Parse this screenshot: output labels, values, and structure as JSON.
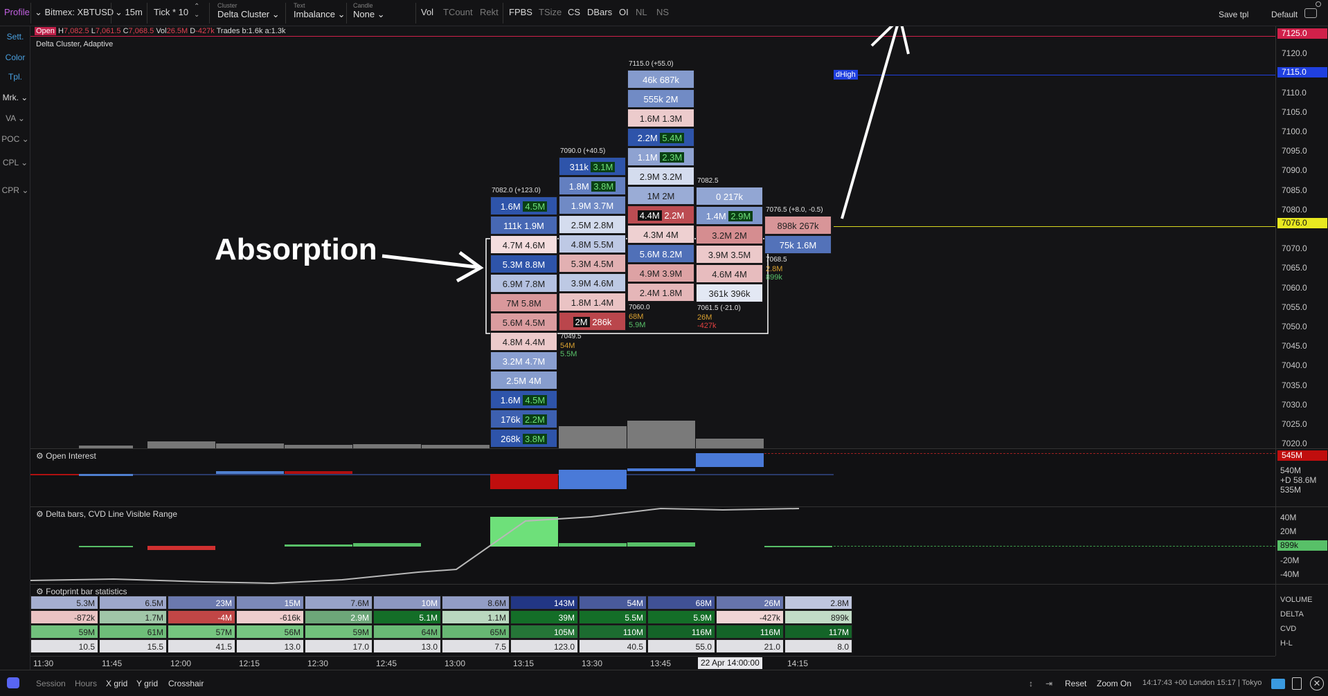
{
  "toolbar": {
    "profile": "Profile",
    "symbol": "Bitmex: XBTUSD",
    "timeframe": "15m",
    "tick": "Tick * 10",
    "cluster_caption": "Cluster",
    "cluster_value": "Delta Cluster",
    "text_caption": "Text",
    "text_value": "Imbalance",
    "candle_caption": "Candle",
    "candle_value": "None",
    "toggles": [
      "Vol",
      "TCount",
      "Rekt",
      "FPBS",
      "TSize",
      "CS",
      "DBars",
      "OI",
      "NL",
      "NS"
    ],
    "save_tpl": "Save tpl",
    "default": "Default"
  },
  "sidebar": [
    "Sett.",
    "Color",
    "Tpl.",
    "Mrk.",
    "VA",
    "POC",
    "CPL",
    "CPR"
  ],
  "chart": {
    "ohlc_open": "Open",
    "ohlc_h_label": "H",
    "ohlc_h": "7,082.5",
    "ohlc_l_label": "L",
    "ohlc_l": "7,061.5",
    "ohlc_c_label": "C",
    "ohlc_c": "7,068.5",
    "vol_label": "Vol",
    "vol": "26.5M",
    "delta_label": "D",
    "delta": "-427k",
    "trades": "Trades b:1.6k a:1.3k",
    "indicator_name": "Delta Cluster, Adaptive",
    "annotation": "Absorption",
    "dhigh": "dHigh",
    "bars": [
      {
        "header": "7082.0 (+123.0)",
        "cells": [
          [
            "1.6M",
            "4.5M"
          ],
          [
            "111k",
            "1.9M"
          ],
          [
            "4.7M",
            "4.6M"
          ],
          [
            "5.3M",
            "8.8M"
          ],
          [
            "6.9M",
            "7.8M"
          ],
          [
            "7M",
            "5.8M"
          ],
          [
            "5.6M",
            "4.5M"
          ],
          [
            "4.8M",
            "4.4M"
          ],
          [
            "3.2M",
            "4.7M"
          ],
          [
            "2.5M",
            "4M"
          ],
          [
            "1.6M",
            "4.5M"
          ],
          [
            "176k",
            "2.2M"
          ],
          [
            "268k",
            "3.8M"
          ]
        ]
      },
      {
        "header": "7090.0 (+40.5)",
        "cells": [
          [
            "311k",
            "3.1M"
          ],
          [
            "1.8M",
            "3.8M"
          ],
          [
            "1.9M",
            "3.7M"
          ],
          [
            "2.5M",
            "2.8M"
          ],
          [
            "4.8M",
            "5.5M"
          ],
          [
            "5.3M",
            "4.5M"
          ],
          [
            "3.9M",
            "4.6M"
          ],
          [
            "1.8M",
            "1.4M"
          ],
          [
            "2M",
            "286k"
          ]
        ],
        "footer": "7049.5",
        "fvol": "54M",
        "fdelta": "5.5M"
      },
      {
        "header": "7115.0 (+55.0)",
        "cells": [
          [
            "46k",
            "687k"
          ],
          [
            "555k",
            "2M"
          ],
          [
            "1.6M",
            "1.3M"
          ],
          [
            "2.2M",
            "5.4M"
          ],
          [
            "1.1M",
            "2.3M"
          ],
          [
            "2.9M",
            "3.2M"
          ],
          [
            "1M",
            "2M"
          ],
          [
            "4.4M",
            "2.2M"
          ],
          [
            "4.3M",
            "4M"
          ],
          [
            "5.6M",
            "8.2M"
          ],
          [
            "4.9M",
            "3.9M"
          ],
          [
            "2.4M",
            "1.8M"
          ]
        ],
        "footer": "7060.0",
        "fvol": "68M",
        "fdelta": "5.9M"
      },
      {
        "header": "7082.5",
        "cells": [
          [
            "0",
            "217k"
          ],
          [
            "1.4M",
            "2.9M"
          ],
          [
            "3.2M",
            "2M"
          ],
          [
            "3.9M",
            "3.5M"
          ],
          [
            "4.6M",
            "4M"
          ],
          [
            "361k",
            "396k"
          ]
        ],
        "footer": "7061.5 (-21.0)",
        "fvol": "26M",
        "fdelta": "-427k"
      },
      {
        "header": "7076.5 (+8.0, -0.5)",
        "cells": [
          [
            "898k",
            "267k"
          ],
          [
            "75k",
            "1.6M"
          ]
        ],
        "footer": "7068.5",
        "fvol": "2.8M",
        "fdelta": "899k"
      }
    ]
  },
  "price_axis": {
    "ticks": [
      "7125.0",
      "7120.0",
      "7115.0",
      "7110.0",
      "7105.0",
      "7100.0",
      "7095.0",
      "7090.0",
      "7085.0",
      "7080.0",
      "7076.0",
      "7070.0",
      "7065.0",
      "7060.0",
      "7055.0",
      "7050.0",
      "7045.0",
      "7040.0",
      "7035.0",
      "7030.0",
      "7025.0",
      "7020.0"
    ],
    "high_badge": "7125.0",
    "dhigh_badge": "7115.0",
    "current_badge": "7076.0"
  },
  "open_interest": {
    "title": "Open Interest",
    "badge": "545M",
    "labels": [
      "540M",
      "+D 58.6M",
      "535M"
    ]
  },
  "delta_pane": {
    "title": "Delta bars, CVD Line Visible Range",
    "labels": [
      "40M",
      "20M",
      "-20M",
      "-40M"
    ],
    "badge": "899k"
  },
  "stats": {
    "title": "Footprint bar statistics",
    "row_labels": [
      "VOLUME",
      "DELTA",
      "CVD",
      "H-L"
    ],
    "volume": [
      "5.3M",
      "6.5M",
      "23M",
      "15M",
      "7.6M",
      "10M",
      "8.6M",
      "143M",
      "54M",
      "68M",
      "26M",
      "2.8M"
    ],
    "delta": [
      "-872k",
      "1.7M",
      "-4M",
      "-616k",
      "2.9M",
      "5.1M",
      "1.1M",
      "39M",
      "5.5M",
      "5.9M",
      "-427k",
      "899k"
    ],
    "cvd": [
      "59M",
      "61M",
      "57M",
      "56M",
      "59M",
      "64M",
      "65M",
      "105M",
      "110M",
      "116M",
      "116M",
      "117M"
    ],
    "hl": [
      "10.5",
      "15.5",
      "41.5",
      "13.0",
      "17.0",
      "13.0",
      "7.5",
      "123.0",
      "40.5",
      "55.0",
      "21.0",
      "8.0"
    ]
  },
  "time_axis": [
    "11:30",
    "11:45",
    "12:00",
    "12:15",
    "12:30",
    "12:45",
    "13:00",
    "13:15",
    "13:30",
    "13:45",
    "22 Apr  14:00:00",
    "14:15"
  ],
  "bottom": {
    "left": [
      "Session",
      "Hours",
      "X grid",
      "Y grid",
      "Crosshair"
    ],
    "reset": "Reset",
    "zoom": "Zoom On",
    "clock": "14:17:43 +00  London 15:17 | Tokyo"
  }
}
